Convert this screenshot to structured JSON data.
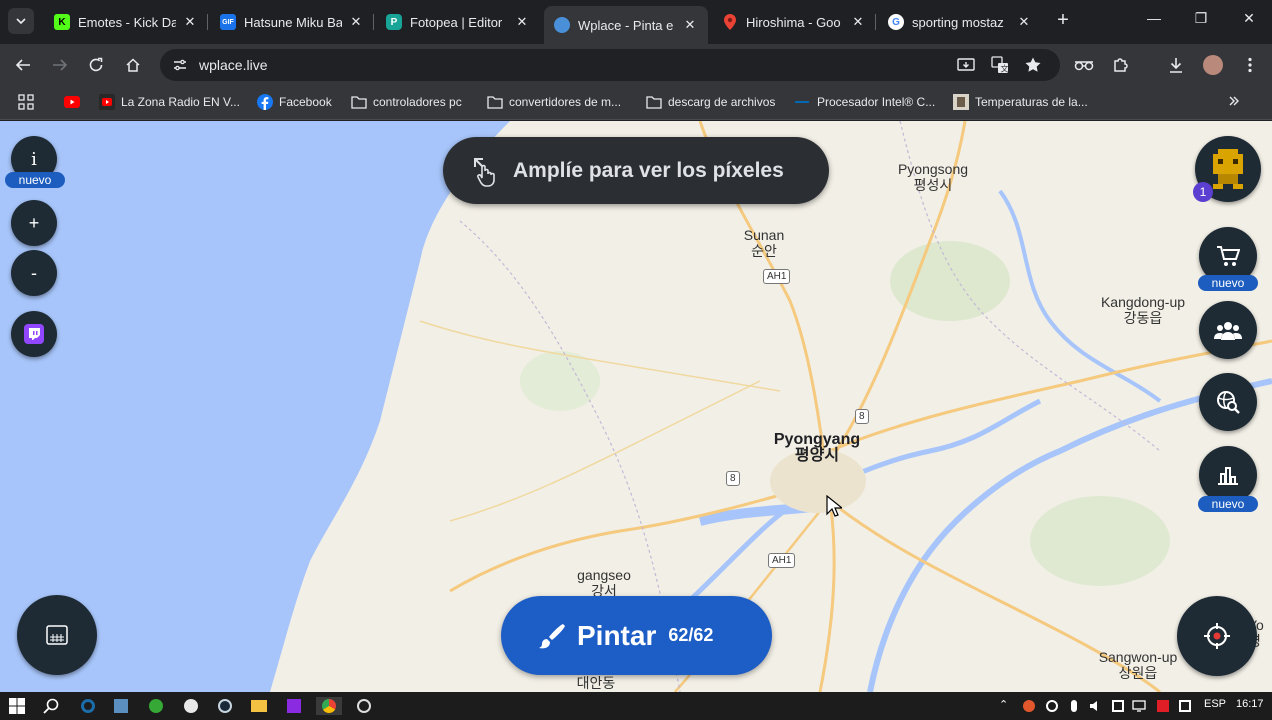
{
  "tabs": [
    {
      "title": "Emotes - Kick Da",
      "favicon": "kick-icon",
      "color": "#53fc18",
      "active": false
    },
    {
      "title": "Hatsune Miku Ba",
      "favicon": "gif-icon",
      "color": "#1a73e8",
      "active": false
    },
    {
      "title": "Fotopea | Editor",
      "favicon": "photopea-icon",
      "color": "#18a497",
      "active": false
    },
    {
      "title": "Wplace - Pinta e",
      "favicon": "globe-icon",
      "color": "#4a90d9",
      "active": true
    },
    {
      "title": "Hiroshima - Goo",
      "favicon": "maps-pin-icon",
      "color": "#ea4335",
      "active": false
    },
    {
      "title": "sporting mostaz",
      "favicon": "google-icon",
      "color": "#ffffff",
      "active": false
    }
  ],
  "address_bar": {
    "url": "wplace.live"
  },
  "bookmarks": [
    {
      "label": "",
      "icon": "youtube-icon"
    },
    {
      "label": "La Zona Radio EN V...",
      "icon": "youtube-icon"
    },
    {
      "label": "Facebook",
      "icon": "facebook-icon"
    },
    {
      "label": "controladores pc",
      "icon": "folder-icon"
    },
    {
      "label": "convertidores de m...",
      "icon": "folder-icon"
    },
    {
      "label": "descarg de archivos",
      "icon": "folder-icon"
    },
    {
      "label": "Procesador Intel® C...",
      "icon": "intel-icon"
    },
    {
      "label": "Temperaturas de la...",
      "icon": "image-icon"
    }
  ],
  "map": {
    "zoom_banner": "Amplíe para ver los píxeles",
    "paint_button": {
      "label": "Pintar",
      "count": "62/62"
    },
    "badge_new": "nuevo",
    "notification_count": "1",
    "places": [
      {
        "name": "Pyongsong",
        "local": "평성시"
      },
      {
        "name": "Sunan",
        "local": "순안"
      },
      {
        "name": "Kangdong-up",
        "local": "강동읍"
      },
      {
        "name": "Pyongyang",
        "local": "평양시"
      },
      {
        "name": "gangseo",
        "local": "강서"
      },
      {
        "name": "Sangwon-up",
        "local": "상원읍"
      },
      {
        "name": "",
        "local": "대안동"
      },
      {
        "name": "Yo",
        "local": "영"
      }
    ],
    "shields": [
      "AH1",
      "8",
      "8",
      "AH1"
    ],
    "colors": {
      "water": "#a7c5fa",
      "land": "#f2efe6",
      "road": "#f5c97e",
      "fab": "#1e2b35",
      "accent": "#1d5dc6"
    }
  },
  "taskbar": {
    "lang": "ESP",
    "time": "16:17"
  }
}
